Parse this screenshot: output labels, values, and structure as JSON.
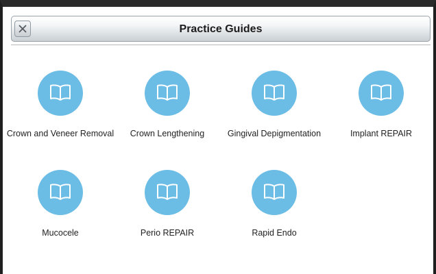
{
  "window": {
    "title": "Practice Guides",
    "close_icon": "close-x-icon"
  },
  "colors": {
    "icon_circle": "#6cbde6",
    "title_text": "#1c1c1c",
    "label_text": "#222222"
  },
  "guides": [
    {
      "label": "Crown and Veneer Removal",
      "icon": "open-book-icon"
    },
    {
      "label": "Crown Lengthening",
      "icon": "open-book-icon"
    },
    {
      "label": "Gingival Depigmentation",
      "icon": "open-book-icon"
    },
    {
      "label": "Implant REPAIR",
      "icon": "open-book-icon"
    },
    {
      "label": "Mucocele",
      "icon": "open-book-icon"
    },
    {
      "label": "Perio REPAIR",
      "icon": "open-book-icon"
    },
    {
      "label": "Rapid Endo",
      "icon": "open-book-icon"
    }
  ]
}
